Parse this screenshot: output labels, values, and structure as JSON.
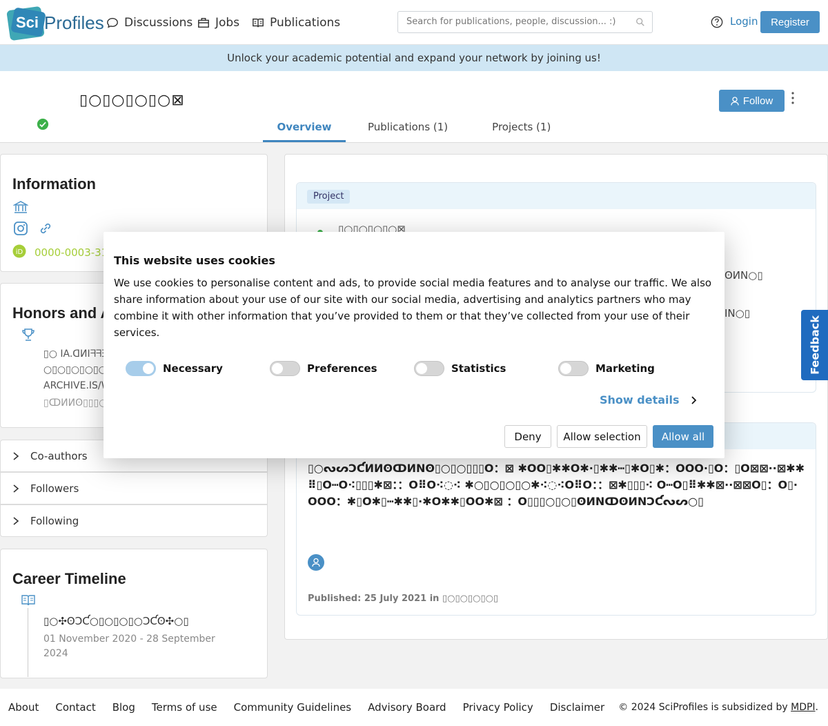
{
  "header": {
    "logo_sci": "Sci",
    "logo_text": "Profiles",
    "nav": [
      {
        "label": "Discussions",
        "icon": "chat-icon"
      },
      {
        "label": "Jobs",
        "icon": "briefcase-icon"
      },
      {
        "label": "Publications",
        "icon": "book-icon"
      }
    ],
    "search_placeholder": "Search for publications, people, discussion... :)",
    "login": "Login",
    "register": "Register"
  },
  "banner": "Unlock your academic potential and expand your network by joining us!",
  "profile": {
    "name": "▯○▯○▯○▯○⊠",
    "follow": "Follow",
    "tabs": [
      "Overview",
      "Publications (1)",
      "Projects (1)"
    ]
  },
  "information": {
    "title": "Information",
    "orcid": "0000-0003-31"
  },
  "honors": {
    "title": "Honors and Aw",
    "line1": "▯○ IA.ᗡИIᖷᖷƎ",
    "line2": "○▯○▯○▯○▯○",
    "line3": "ARCHIVE.IS/W",
    "line4": "▯ↀИИʘ▯▯▯○"
  },
  "collapse": [
    "Co-authors",
    "Followers",
    "Following"
  ],
  "career": {
    "title": "Career Timeline",
    "item_title": "▯○✣ʘƆƇ○▯○▯○▯○ƆƇʘ✣○▯",
    "item_date": "01 November 2020 - 28 September 2024"
  },
  "project": {
    "badge": "Project",
    "title": "▯○▯○▯○▯○⊠",
    "right1": "ʘИN○▯",
    "right2": "IN○▯"
  },
  "publication": {
    "title": "▯○ᔓᔕƆƇИИʘↀИNʘ▯○▯○▯▯▯O：⊠ ✱OO▯✱✱O✱·▯✱✱┅▯✱O▯✱：OOO·▯O：▯O⊠⊠··⊠✱✱⠿▯O┅O⁖▯▯▯✱⊠：：O⠿O⁖◌⁖ ✱○▯○▯○▯○✱⁖◌⁖O⠿O：：⊠✱▯▯▯⁖ O┅O▯⠿✱✱⊠··⊠⊠O▯：O▯·OOO：✱▯O✱▯┅✱✱▯·✱O✱✱▯OO✱⊠ ：O▯▯▯○▯○▯ʘИNↀʘИNƆƇᔓᔕ○▯",
    "meta": "Published: 25 July 2021 in ▯○▯○▯○▯○▯"
  },
  "cookie": {
    "title": "This website uses cookies",
    "body": "We use cookies to personalise content and ads, to provide social media features and to analyse our traffic. We also share information about your use of our site with our social media, advertising and analytics partners who may combine it with other information that you’ve provided to them or that they’ve collected from your use of their services.",
    "toggles": [
      {
        "label": "Necessary",
        "on": true
      },
      {
        "label": "Preferences",
        "on": false
      },
      {
        "label": "Statistics",
        "on": false
      },
      {
        "label": "Marketing",
        "on": false
      }
    ],
    "show_details": "Show details",
    "deny": "Deny",
    "allow_selection": "Allow selection",
    "allow_all": "Allow all"
  },
  "feedback": "Feedback",
  "footer": {
    "links": [
      "About",
      "Contact",
      "Blog",
      "Terms of use",
      "Community Guidelines",
      "Advisory Board",
      "Privacy Policy",
      "Disclaimer"
    ],
    "copyright_prefix": "© 2024 SciProfiles is subsidized by ",
    "copyright_link": "MDPI",
    "copyright_suffix": "."
  },
  "colors": {
    "accent": "#4a90c6",
    "banner": "#cfe6f4",
    "orcid": "#a6ce39",
    "verified": "#3db04a",
    "feedback": "#1f6bbf"
  }
}
